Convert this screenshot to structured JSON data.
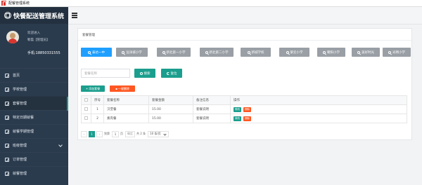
{
  "window": {
    "title": "配餐管理系统"
  },
  "brand": {
    "name": "快餐配送管理系统"
  },
  "user": {
    "welcome": "欢迎进入",
    "name": "靳磊【管理员】",
    "phone": "手机:18850331555"
  },
  "menu": {
    "items": [
      {
        "label": "首页"
      },
      {
        "label": "学校管理"
      },
      {
        "label": "套餐管理"
      },
      {
        "label": "特定日期就餐"
      },
      {
        "label": "就餐学期管理"
      },
      {
        "label": "班级管理"
      },
      {
        "label": "订单管理"
      },
      {
        "label": "就餐管理"
      }
    ]
  },
  "breadcrumb": "套餐管理",
  "schools": [
    {
      "label": "泰达一中"
    },
    {
      "label": "远洋城小学"
    },
    {
      "label": "新北第一小学"
    },
    {
      "label": "新北第二小学"
    },
    {
      "label": "新城学校"
    },
    {
      "label": "紫云小学"
    },
    {
      "label": "朝阳小学"
    },
    {
      "label": "美好时光"
    },
    {
      "label": "光明小学"
    }
  ],
  "search": {
    "placeholder": "套餐名称",
    "search_label": "搜索",
    "reset_label": "复位"
  },
  "actions": {
    "add_label": "添加套餐",
    "batch_delete_label": "一键删除"
  },
  "table": {
    "headers": {
      "index": "序号",
      "name": "套餐名称",
      "amount": "套餐金额",
      "remark": "备注信息",
      "ops": "操作"
    },
    "rows": [
      {
        "index": "1",
        "name": "汉堡餐",
        "amount": "15.00",
        "remark": "套餐说明"
      },
      {
        "index": "2",
        "name": "素肉餐",
        "amount": "15.00",
        "remark": "套餐说明"
      }
    ],
    "edit_label": "修改",
    "delete_label": "删除"
  },
  "pager": {
    "current": "1",
    "goto_label": "到第",
    "page_value": "1",
    "page_unit": "页",
    "confirm_label": "确定",
    "total": "共 2 条",
    "page_size": "10 条/页"
  },
  "colors": {
    "sidebar": "#2b3b4e",
    "primary": "#1e9fff",
    "teal": "#1b9e8d",
    "danger": "#ff5722",
    "gray": "#999fa5"
  }
}
